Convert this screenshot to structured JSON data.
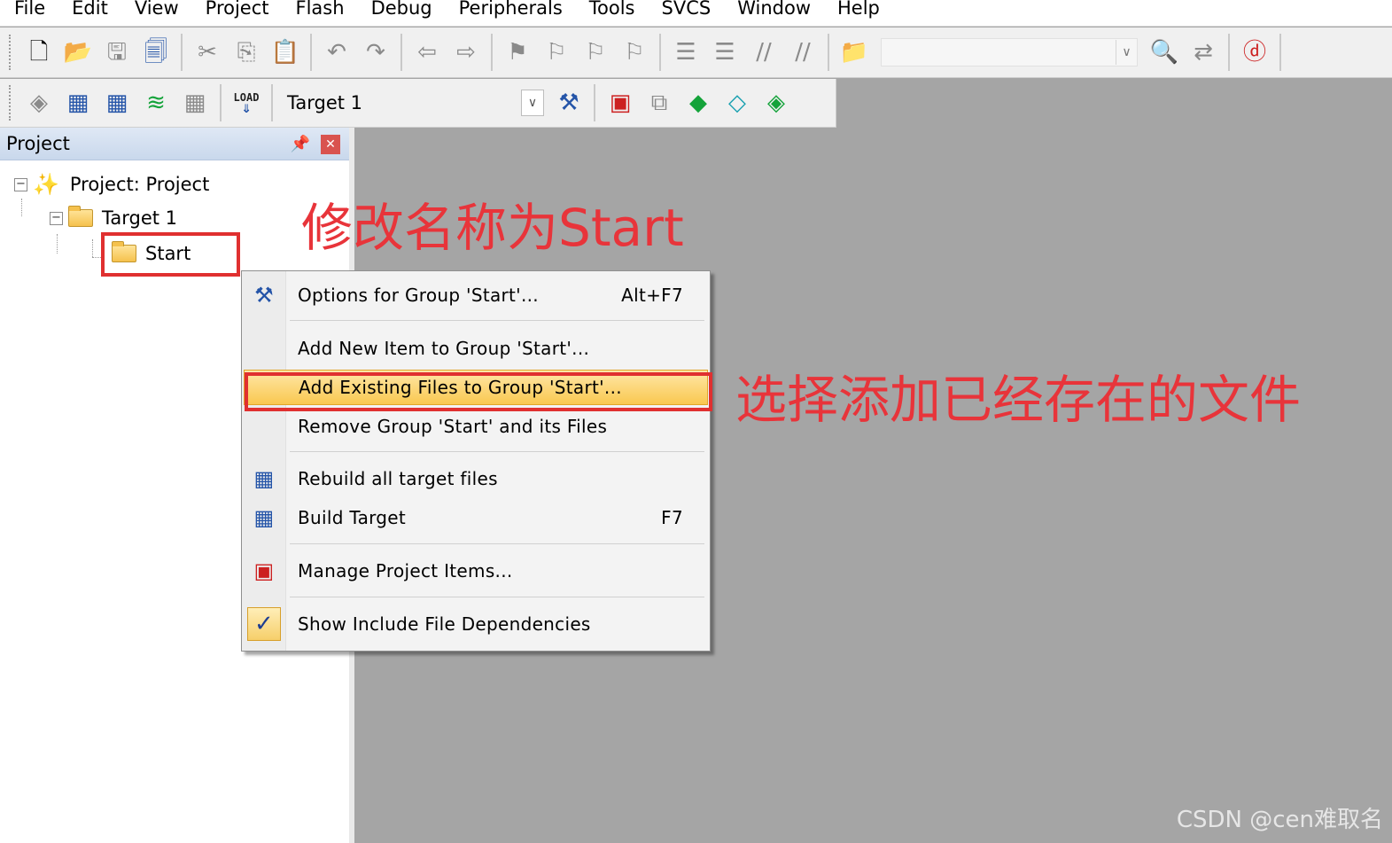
{
  "menubar": {
    "items": [
      "File",
      "Edit",
      "View",
      "Project",
      "Flash",
      "Debug",
      "Peripherals",
      "Tools",
      "SVCS",
      "Window",
      "Help"
    ]
  },
  "toolbar1": {
    "icons": [
      "new-file-icon",
      "open-folder-icon",
      "save-icon",
      "save-all-icon",
      "cut-icon",
      "copy-icon",
      "paste-icon",
      "undo-icon",
      "redo-icon",
      "back-icon",
      "forward-icon",
      "bookmark-icon",
      "bookmark-prev-icon",
      "bookmark-next-icon",
      "bookmark-clear-icon",
      "indent-icon",
      "unindent-icon",
      "comment-icon",
      "uncomment-icon",
      "find-in-files-icon",
      "search-combo",
      "find-icon",
      "incremental-find-icon",
      "debug-icon"
    ]
  },
  "toolbar2": {
    "target_name": "Target 1",
    "load_label": "LOAD"
  },
  "project_panel": {
    "title": "Project",
    "tree": {
      "root": "Project: Project",
      "target": "Target 1",
      "group": "Start"
    }
  },
  "context_menu": {
    "items": [
      {
        "label": "Options for Group 'Start'...",
        "shortcut": "Alt+F7"
      },
      {
        "label": "Add New  Item to Group 'Start'...",
        "shortcut": ""
      },
      {
        "label": "Add Existing Files to Group 'Start'...",
        "shortcut": ""
      },
      {
        "label": "Remove Group 'Start' and its Files",
        "shortcut": ""
      },
      {
        "label": "Rebuild all target files",
        "shortcut": ""
      },
      {
        "label": "Build Target",
        "shortcut": "F7"
      },
      {
        "label": "Manage Project Items...",
        "shortcut": ""
      },
      {
        "label": "Show Include File Dependencies",
        "shortcut": ""
      }
    ],
    "highlighted_index": 2,
    "checked_index": 7
  },
  "annotations": {
    "rename": "修改名称为Start",
    "select_existing": "选择添加已经存在的文件"
  },
  "watermark": "CSDN @cen难取名",
  "colors": {
    "annotation_red": "#e8343a",
    "highlight": "#f9c850",
    "workspace": "#a5a5a5"
  }
}
